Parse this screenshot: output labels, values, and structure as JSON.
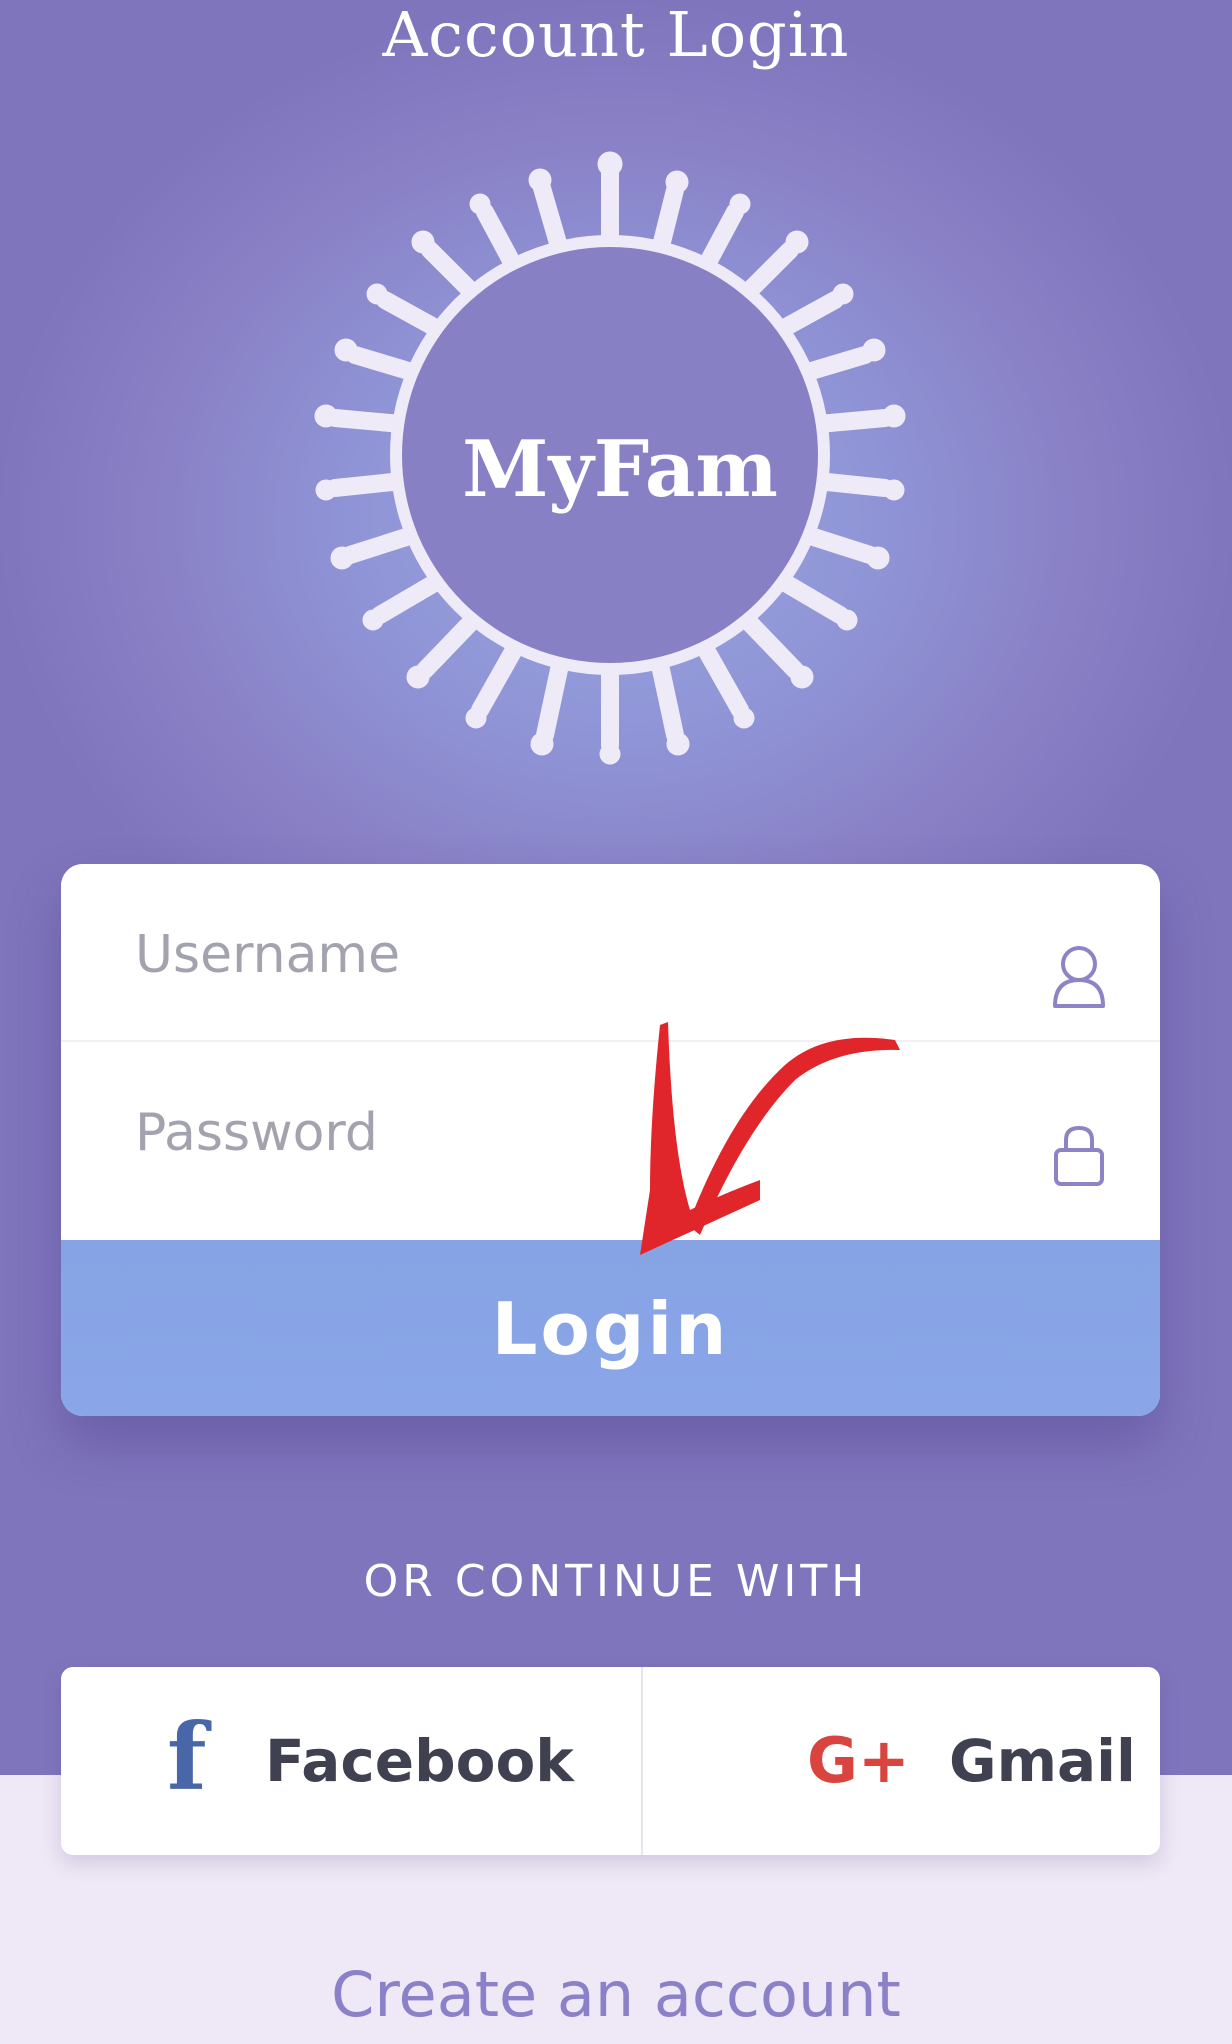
{
  "header": {
    "title": "Account Login"
  },
  "logo": {
    "text": "MyFam"
  },
  "form": {
    "username_placeholder": "Username",
    "password_placeholder": "Password",
    "login_label": "Login"
  },
  "social": {
    "divider_text": "OR CONTINUE WITH",
    "facebook": {
      "glyph": "f",
      "label": "Facebook",
      "icon": "facebook-icon"
    },
    "gmail": {
      "glyph": "G+",
      "label": "Gmail",
      "icon": "google-plus-icon"
    }
  },
  "footer": {
    "create_account": "Create an account"
  },
  "colors": {
    "background": "#8a80c6",
    "login_button": "#8aa6e8",
    "facebook": "#4967a8",
    "google": "#d9453e",
    "annotation_arrow": "#e0262b"
  }
}
